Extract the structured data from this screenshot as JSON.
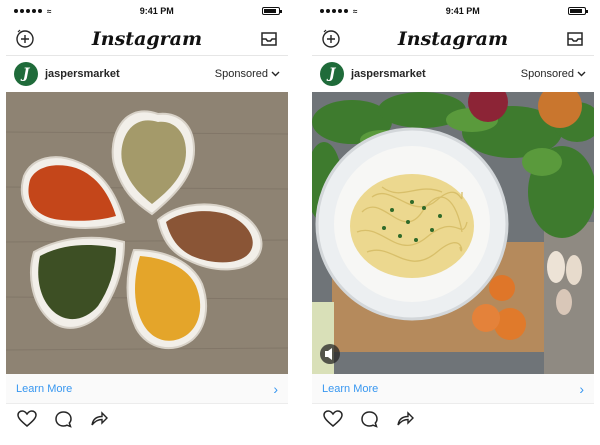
{
  "phones": [
    {
      "status": {
        "time": "9:41 PM"
      },
      "app": {
        "title": "Instagram"
      },
      "post": {
        "username": "jaspersmarket",
        "avatar_letter": "J",
        "sponsored_label": "Sponsored",
        "cta_label": "Learn More"
      }
    },
    {
      "status": {
        "time": "9:41 PM"
      },
      "app": {
        "title": "Instagram"
      },
      "post": {
        "username": "jaspersmarket",
        "avatar_letter": "J",
        "sponsored_label": "Sponsored",
        "cta_label": "Learn More"
      }
    }
  ],
  "icons": {
    "new_post": "add-post-icon",
    "inbox": "inbox-icon",
    "like": "heart-icon",
    "comment": "comment-icon",
    "share": "share-icon",
    "sponsored_menu": "chevron-down-icon",
    "cta_arrow": "chevron-right-icon",
    "volume": "volume-icon"
  },
  "colors": {
    "link_blue": "#3897f0",
    "avatar_green": "#1f6b3a"
  }
}
